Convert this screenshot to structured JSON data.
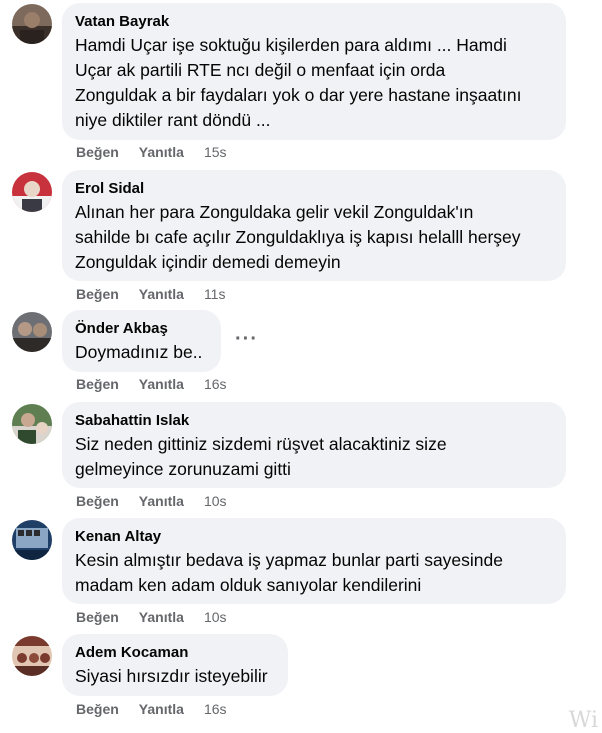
{
  "actions": {
    "like_label": "Beğen",
    "reply_label": "Yanıtla"
  },
  "comments": [
    {
      "author": "Vatan Bayrak",
      "lines": [
        "Hamdi Uçar işe soktuğu kişilerden para aldımı ... Hamdi",
        "Uçar ak partili RTE ncı değil o menfaat için orda",
        "Zonguldak a bir faydaları yok o dar yere hastane inşaatını",
        "niye diktiler rant döndü ..."
      ],
      "time": "15s",
      "avatar_colors": [
        "#3b2f2a",
        "#9a7f6b"
      ]
    },
    {
      "author": "Erol Sidal",
      "lines": [
        "Alınan her para Zonguldaka gelir vekil Zonguldak'ın",
        "sahilde bı cafe açılır Zonguldaklıya iş kapısı helalll herşey",
        "Zonguldak içindir demedi demeyin"
      ],
      "time": "11s",
      "avatar_colors": [
        "#c8323c",
        "#e8d6c8"
      ]
    },
    {
      "author": "Önder Akbaş",
      "lines": [
        "Doymadınız be.."
      ],
      "time": "16s",
      "avatar_colors": [
        "#2d2a28",
        "#b49a86"
      ]
    },
    {
      "author": "Sabahattin Islak",
      "lines": [
        "Siz neden gittiniz sizdemi rüşvet alacaktiniz size",
        "gelmeyince zorunuzami gitti"
      ],
      "time": "10s",
      "avatar_colors": [
        "#2f4a2e",
        "#d9d4ce"
      ]
    },
    {
      "author": "Kenan Altay",
      "lines": [
        "Kesin almıştır bedava iş yapmaz bunlar parti sayesinde",
        "madam ken adam olduk sanıyolar kendilerini"
      ],
      "time": "10s",
      "avatar_colors": [
        "#1f3f66",
        "#8aa6c4"
      ]
    },
    {
      "author": "Adem Kocaman",
      "lines": [
        "Siyasi hırsızdır isteyebilir"
      ],
      "time": "16s",
      "avatar_colors": [
        "#7a3b2e",
        "#e2c6b4"
      ]
    }
  ],
  "more_options_icon": "ellipsis-icon",
  "watermark_text": "Wi"
}
